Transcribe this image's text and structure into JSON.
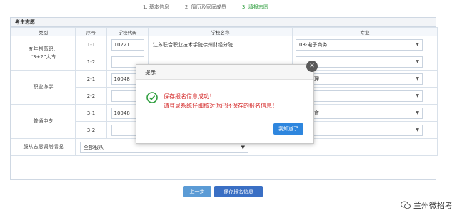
{
  "steps": [
    "1. 基本信息",
    "2. 简历及家庭成员",
    "3. 填报志愿"
  ],
  "panel": {
    "title": "考生志愿",
    "headers": [
      "类别",
      "序号",
      "学校代码",
      "学校名称",
      "专业"
    ],
    "groups": [
      {
        "category": "五年制高职、\n“3+2”大专",
        "rows": [
          {
            "seq": "1-1",
            "code": "10221",
            "school": "江苏联合职业技术学院徐州财经分院",
            "major": "03-电子商务"
          },
          {
            "seq": "1-2",
            "code": "",
            "school": "",
            "major": ""
          }
        ]
      },
      {
        "category": "职业办学",
        "rows": [
          {
            "seq": "2-1",
            "code": "10048",
            "school": "",
            "major": "酒店管理"
          },
          {
            "seq": "2-2",
            "code": "",
            "school": "",
            "major": ""
          }
        ]
      },
      {
        "category": "普通中专",
        "rows": [
          {
            "seq": "3-1",
            "code": "10048",
            "school": "",
            "major": "学前教育"
          },
          {
            "seq": "3-2",
            "code": "",
            "school": "",
            "major": ""
          }
        ]
      }
    ],
    "obey_label": "服从志愿调剂情况",
    "obey_value": "全部服从"
  },
  "buttons": {
    "prev": "上一步",
    "save": "保存报名信息"
  },
  "dialog": {
    "title": "提示",
    "line1": "保存报名信息成功！",
    "line2": "请登录系统仔细核对你已经保存的报名信息！",
    "ok": "我知道了"
  },
  "watermark": "兰州微招考",
  "colors": {
    "active_step": "#2e9e3e",
    "primary": "#2e86de",
    "error": "#d42a2a"
  }
}
